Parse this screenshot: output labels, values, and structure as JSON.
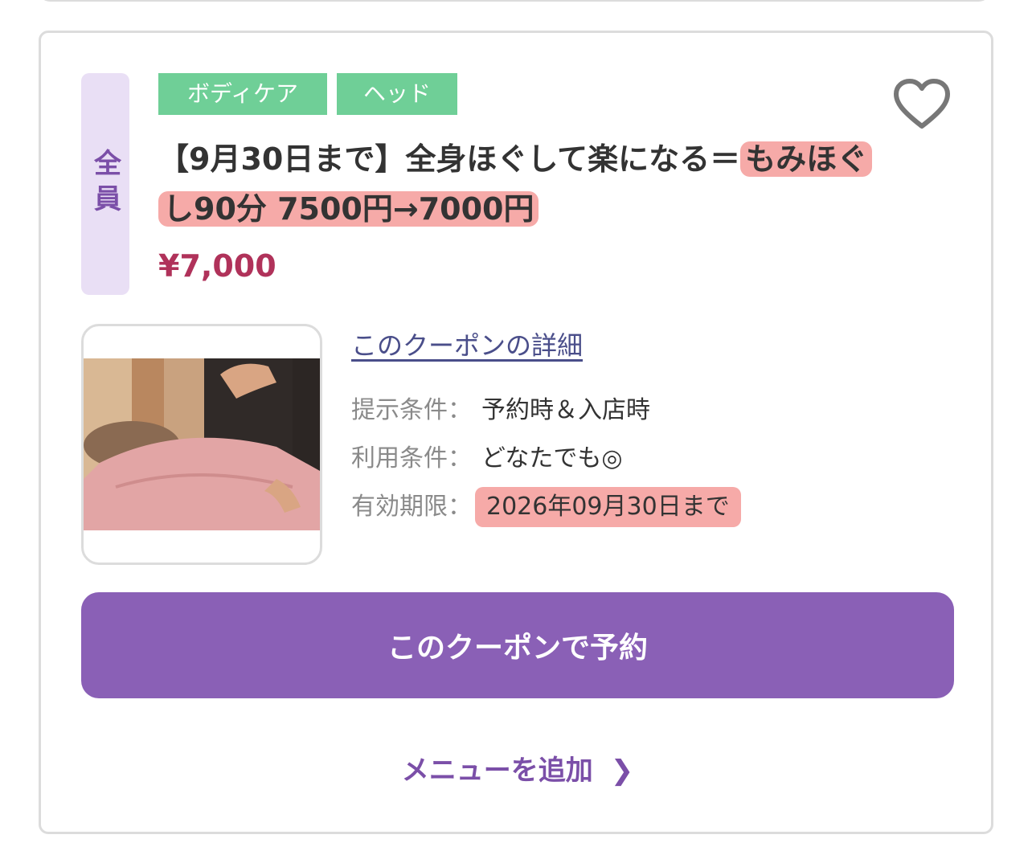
{
  "card": {
    "target_label": "全員",
    "tags": [
      "ボディケア",
      "ヘッド"
    ],
    "title_plain": "【9月30日まで】全身ほぐして楽になる＝",
    "title_highlight": "もみほぐし90分 7500円→7000円",
    "price": "¥7,000",
    "favorite_icon": "heart-outline-icon",
    "details_link": "このクーポンの詳細",
    "conditions": [
      {
        "label": "提示条件：",
        "value": "予約時＆入店時"
      },
      {
        "label": "利用条件：",
        "value": "どなたでも◎"
      },
      {
        "label": "有効期限：",
        "value": "2026年09月30日まで"
      }
    ],
    "reserve_button": "このクーポンで予約",
    "add_menu": "メニューを追加",
    "add_menu_icon": "chevron-right-icon"
  },
  "colors": {
    "accent": "#8a60b6",
    "tag_green": "#6fcf97",
    "price_red": "#b0325a",
    "highlight": "#f6aaa8"
  }
}
